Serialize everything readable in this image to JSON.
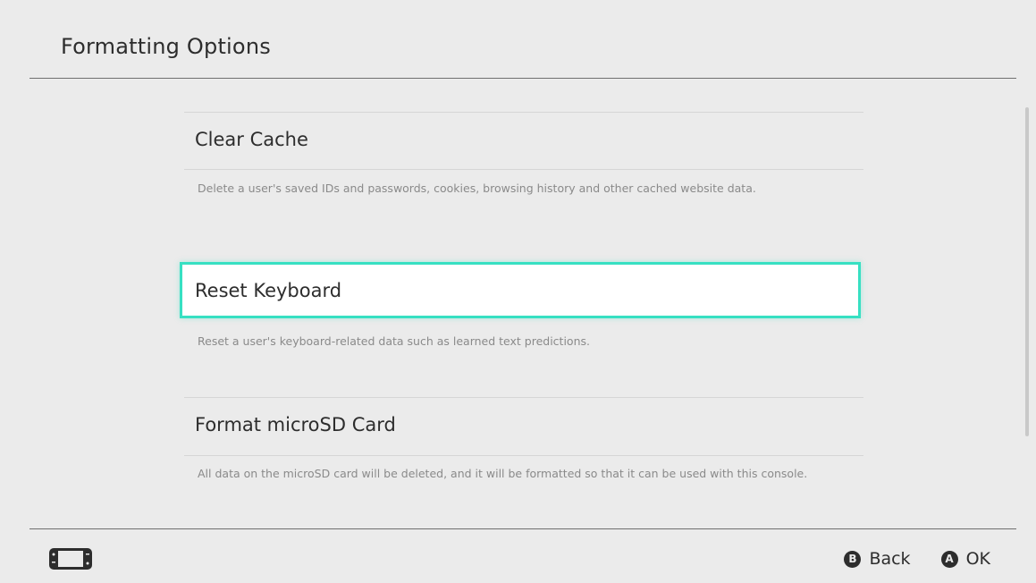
{
  "header": {
    "title": "Formatting Options"
  },
  "options": [
    {
      "label": "Clear Cache",
      "description": "Delete a user's saved IDs and passwords, cookies, browsing history and other cached website data.",
      "selected": false
    },
    {
      "label": "Reset Keyboard",
      "description": "Reset a user's keyboard-related data such as learned text predictions.",
      "selected": true
    },
    {
      "label": "Format microSD Card",
      "description": "All data on the microSD card will be deleted, and it will be formatted so that it can be used with this console.",
      "selected": false
    }
  ],
  "footer": {
    "device_icon": "handheld-console-icon",
    "back": {
      "glyph": "B",
      "label": "Back"
    },
    "ok": {
      "glyph": "A",
      "label": "OK"
    }
  },
  "colors": {
    "background": "#ebebeb",
    "selection": "#37e0c2",
    "text": "#2d2d2d",
    "secondary_text": "#8a8a8a"
  }
}
